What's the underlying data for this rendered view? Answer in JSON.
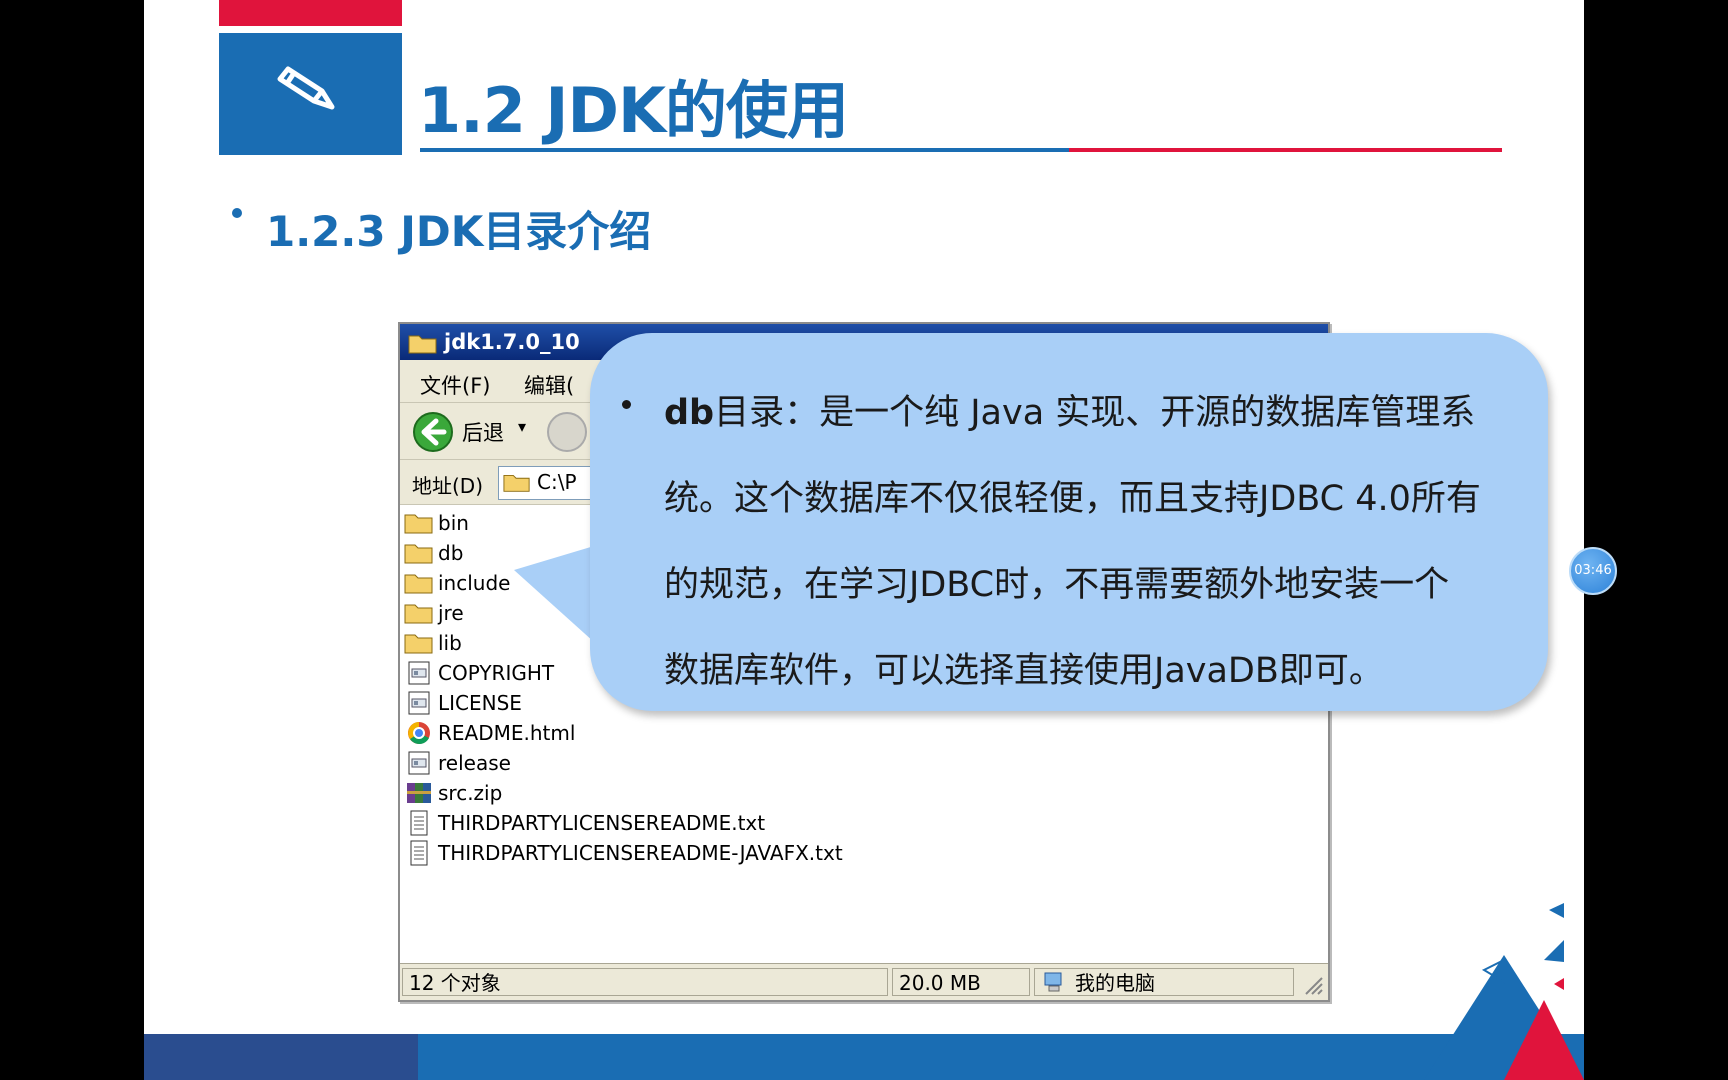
{
  "slide": {
    "title": "1.2 JDK的使用",
    "subtitle": "1.2.3 JDK目录介绍"
  },
  "window": {
    "title": "jdk1.7.0_10",
    "menu": [
      "文件(F)",
      "编辑("
    ],
    "toolbar": {
      "back_label": "后退"
    },
    "address": {
      "label": "地址(D)",
      "value": "C:\\P"
    },
    "files": [
      {
        "name": "bin",
        "icon": "folder-icon"
      },
      {
        "name": "db",
        "icon": "folder-icon"
      },
      {
        "name": "include",
        "icon": "folder-icon"
      },
      {
        "name": "jre",
        "icon": "folder-icon"
      },
      {
        "name": "lib",
        "icon": "folder-icon"
      },
      {
        "name": "COPYRIGHT",
        "icon": "file-icon"
      },
      {
        "name": "LICENSE",
        "icon": "file-icon"
      },
      {
        "name": "README.html",
        "icon": "chrome-icon"
      },
      {
        "name": "release",
        "icon": "file-icon"
      },
      {
        "name": "src.zip",
        "icon": "zip-icon"
      },
      {
        "name": "THIRDPARTYLICENSEREADME.txt",
        "icon": "text-file-icon"
      },
      {
        "name": "THIRDPARTYLICENSEREADME-JAVAFX.txt",
        "icon": "text-file-icon"
      }
    ],
    "status": {
      "count": "12 个对象",
      "size": "20.0 MB",
      "location": "我的电脑"
    }
  },
  "callout": {
    "term": "db",
    "text_line1_rest": "目录：是一个纯 Java 实现、开源的数据库管理系",
    "text_line2": "统。这个数据库不仅很轻便，而且支持JDBC 4.0所有",
    "text_line3": "的规范，在学习JDBC时，不再需要额外地安装一个",
    "text_line4": "数据库软件，可以选择直接使用JavaDB即可。"
  },
  "timer": "03:46",
  "colors": {
    "brand_blue": "#1a6db3",
    "brand_red": "#e0143c",
    "callout_bg": "#a9cff7"
  }
}
